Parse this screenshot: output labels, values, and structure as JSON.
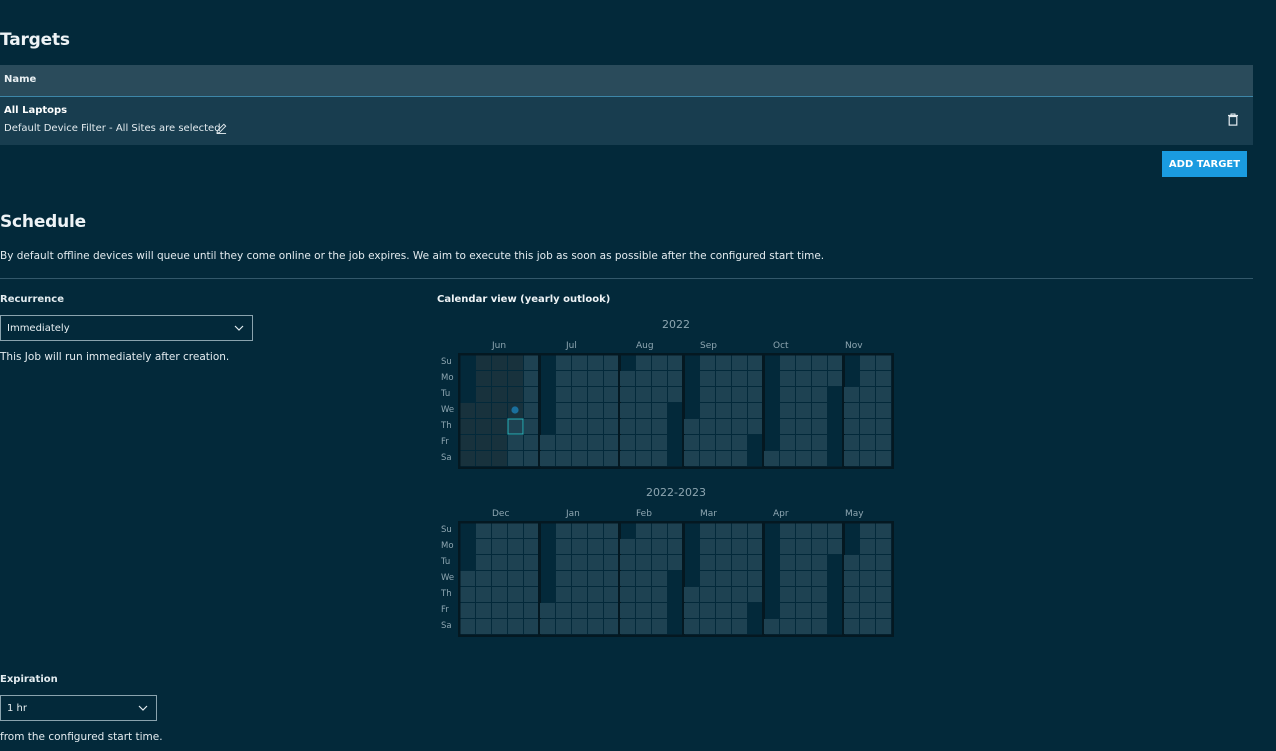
{
  "targets": {
    "title": "Targets",
    "column_name": "Name",
    "rows": [
      {
        "name": "All Laptops",
        "filter": "Default Device Filter - All Sites are selected"
      }
    ],
    "add_button": "ADD TARGET"
  },
  "schedule": {
    "title": "Schedule",
    "description": "By default offline devices will queue until they come online or the job expires. We aim to execute this job as soon as possible after the configured start time.",
    "recurrence": {
      "label": "Recurrence",
      "value": "Immediately",
      "help": "This Job will run immediately after creation."
    },
    "expiration": {
      "label": "Expiration",
      "value": "1 hr",
      "help": "from the configured start time."
    }
  },
  "calendar": {
    "title": "Calendar view (yearly outlook)",
    "day_labels": [
      "Su",
      "Mo",
      "Tu",
      "We",
      "Th",
      "Fr",
      "Sa"
    ],
    "blocks": [
      {
        "year_label": "2022",
        "months": [
          "Jun",
          "Jul",
          "Aug",
          "Sep",
          "Oct",
          "Nov"
        ]
      },
      {
        "year_label": "2022-2023",
        "months": [
          "Dec",
          "Jan",
          "Feb",
          "Mar",
          "Apr",
          "May"
        ]
      }
    ],
    "colors": {
      "cell": "#1e4252",
      "past_cell": "#18323d",
      "border": "#041821",
      "event_dot": "#1a6f9c",
      "selected_outline": "#2fb3b8"
    }
  }
}
